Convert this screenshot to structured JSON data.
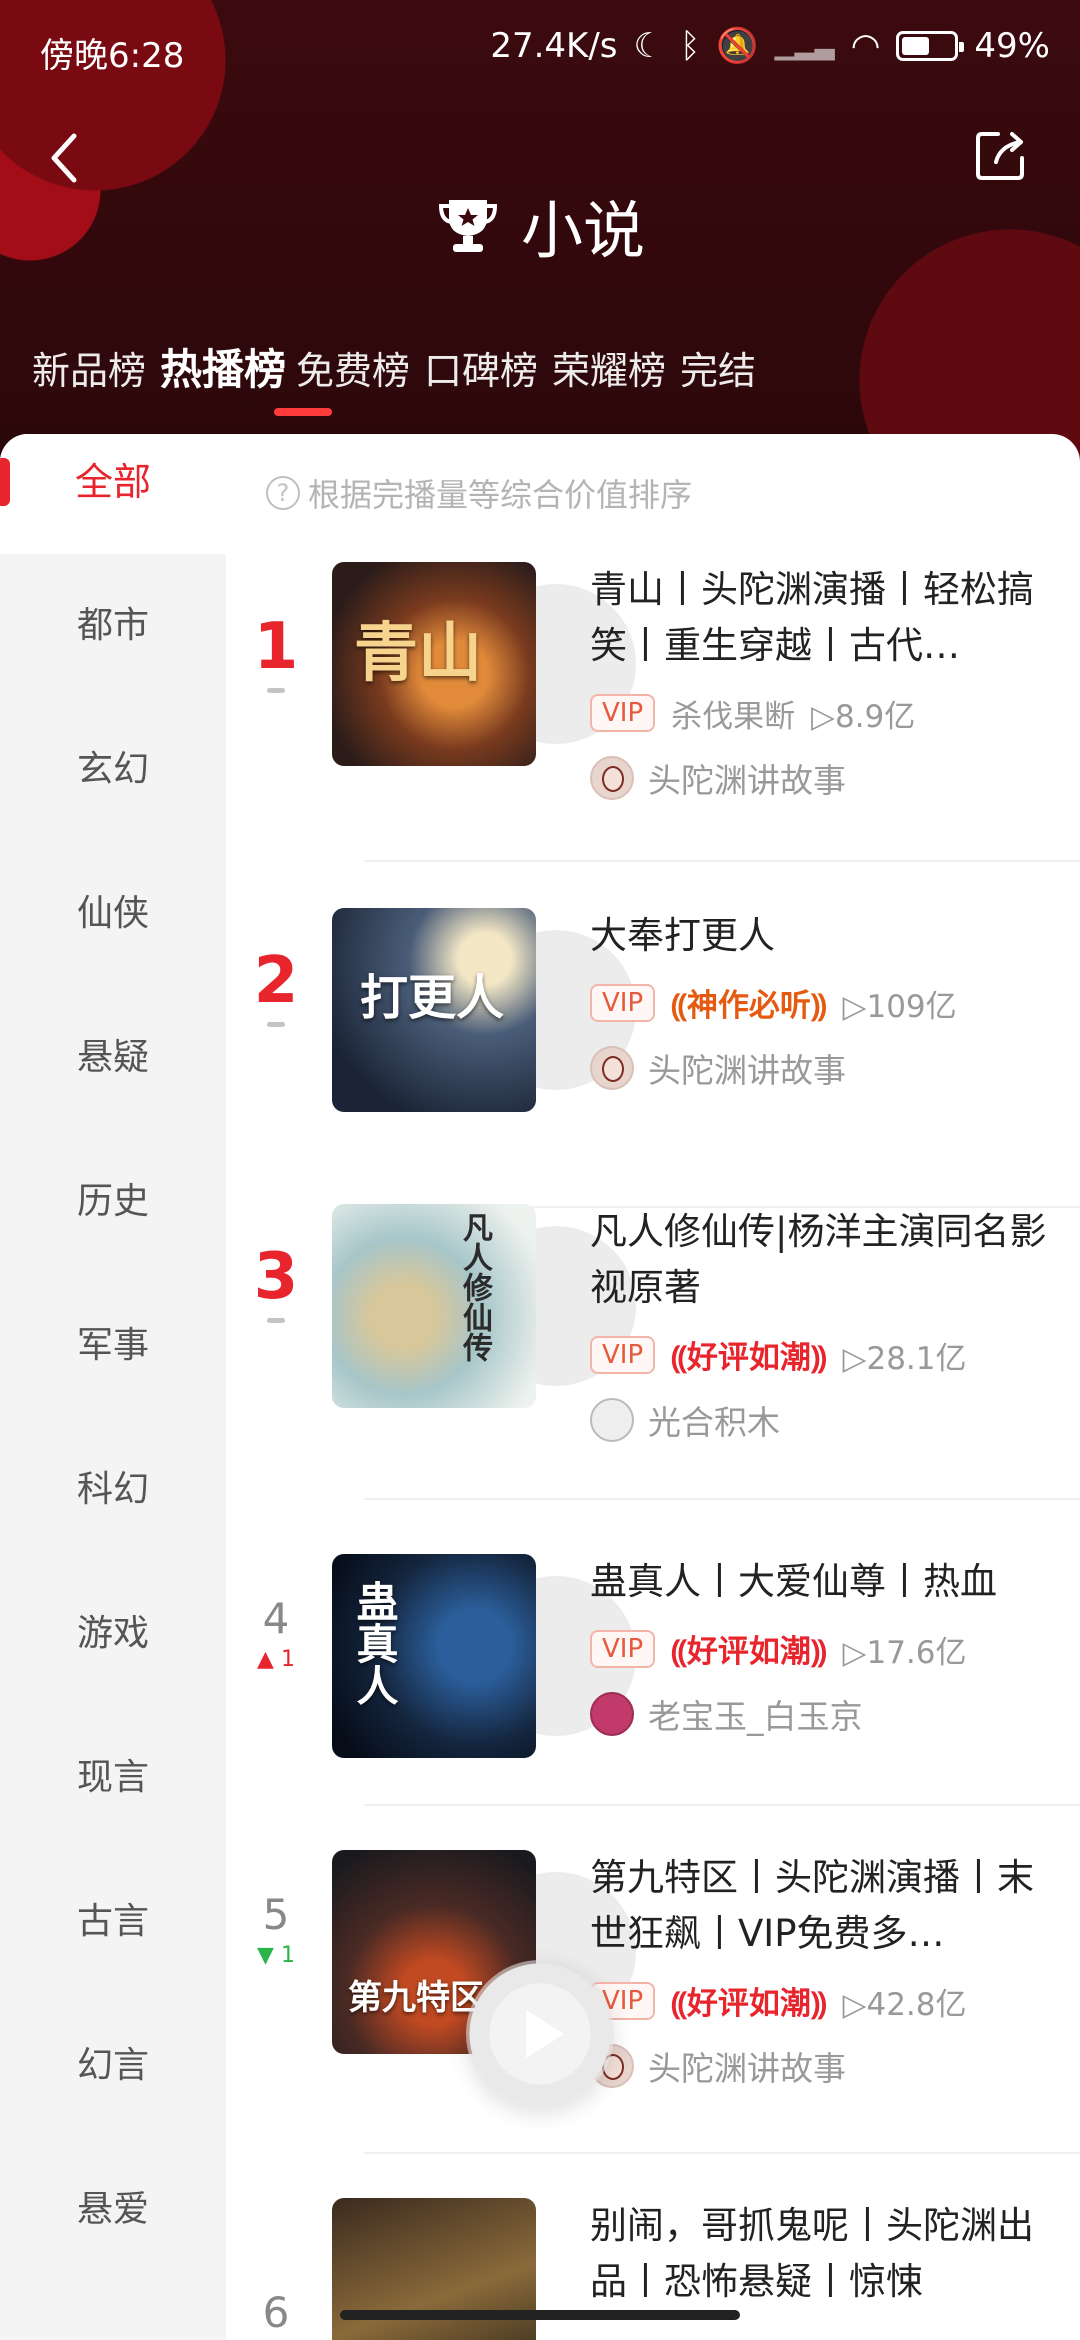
{
  "status_bar": {
    "time": "傍晚6:28",
    "speed": "27.4K/s",
    "battery": "49%"
  },
  "header": {
    "title": "小说"
  },
  "tabs": [
    {
      "label": "新品榜"
    },
    {
      "label": "热播榜"
    },
    {
      "label": "免费榜"
    },
    {
      "label": "口碑榜"
    },
    {
      "label": "荣耀榜"
    },
    {
      "label": "完结"
    }
  ],
  "sidebar": {
    "items": [
      {
        "label": "全部"
      },
      {
        "label": "都市"
      },
      {
        "label": "玄幻"
      },
      {
        "label": "仙侠"
      },
      {
        "label": "悬疑"
      },
      {
        "label": "历史"
      },
      {
        "label": "军事"
      },
      {
        "label": "科幻"
      },
      {
        "label": "游戏"
      },
      {
        "label": "现言"
      },
      {
        "label": "古言"
      },
      {
        "label": "幻言"
      },
      {
        "label": "悬爱"
      }
    ]
  },
  "hint": {
    "text": "根据完播量等综合价值排序"
  },
  "list": [
    {
      "rank": "1",
      "title": "青山丨头陀渊演播丨轻松搞笑丨重生穿越丨古代…",
      "vip": "VIP",
      "tag": "杀伐果断",
      "plays": "8.9亿",
      "author": "头陀渊讲故事",
      "cover_text": "青山"
    },
    {
      "rank": "2",
      "title": "大奉打更人",
      "vip": "VIP",
      "tag": "神作必听",
      "plays": "109亿",
      "author": "头陀渊讲故事",
      "cover_text": "打更人"
    },
    {
      "rank": "3",
      "title": "凡人修仙传|杨洋主演同名影视原著",
      "vip": "VIP",
      "tag": "好评如潮",
      "plays": "28.1亿",
      "author": "光合积木",
      "cover_text": "凡人修仙传"
    },
    {
      "rank": "4",
      "rank_change": "1",
      "title": "蛊真人丨大爱仙尊丨热血",
      "vip": "VIP",
      "tag": "好评如潮",
      "plays": "17.6亿",
      "author": "老宝玉_白玉京",
      "cover_text": "蛊真人"
    },
    {
      "rank": "5",
      "rank_change": "1",
      "title": "第九特区丨头陀渊演播丨末世狂飙丨VIP免费多…",
      "vip": "VIP",
      "tag": "好评如潮",
      "plays": "42.8亿",
      "author": "头陀渊讲故事",
      "cover_text": "第九特区"
    },
    {
      "rank": "6",
      "title": "别闹，哥抓鬼呢丨头陀渊出品丨恐怖悬疑丨惊悚"
    }
  ]
}
